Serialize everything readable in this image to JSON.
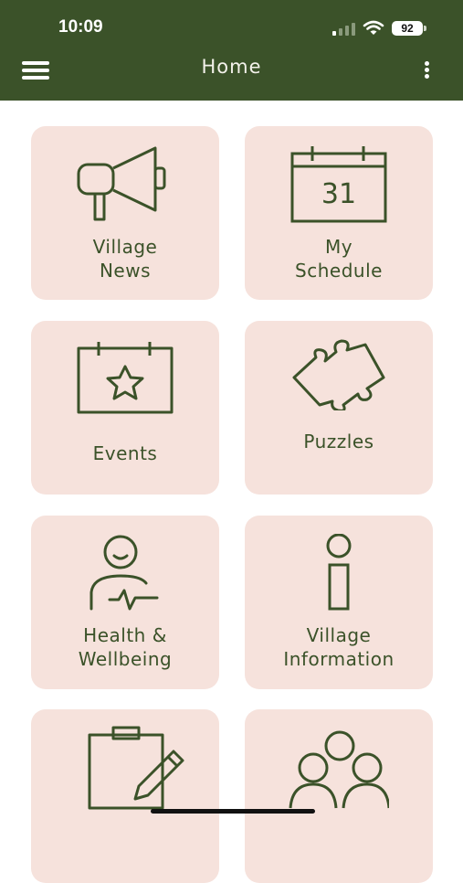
{
  "status_bar": {
    "time": "10:09",
    "battery": "92"
  },
  "header": {
    "title": "Home",
    "menu_icon": "hamburger-icon",
    "more_icon": "more-vertical-icon"
  },
  "tiles": [
    {
      "label_line1": "Village",
      "label_line2": "News",
      "icon": "megaphone-icon"
    },
    {
      "label_line1": "My",
      "label_line2": "Schedule",
      "icon": "calendar-icon",
      "icon_text": "31"
    },
    {
      "label_line1": "Events",
      "label_line2": "",
      "icon": "calendar-star-icon"
    },
    {
      "label_line1": "Puzzles",
      "label_line2": "",
      "icon": "puzzle-piece-icon"
    },
    {
      "label_line1": "Health &",
      "label_line2": "Wellbeing",
      "icon": "person-heartbeat-icon"
    },
    {
      "label_line1": "Village",
      "label_line2": "Information",
      "icon": "info-icon"
    },
    {
      "label_line1": "",
      "label_line2": "",
      "icon": "clipboard-pencil-icon"
    },
    {
      "label_line1": "",
      "label_line2": "",
      "icon": "group-icon"
    }
  ],
  "colors": {
    "header": "#3b5229",
    "tile": "#f6e2dc",
    "ink": "#3b5229"
  }
}
